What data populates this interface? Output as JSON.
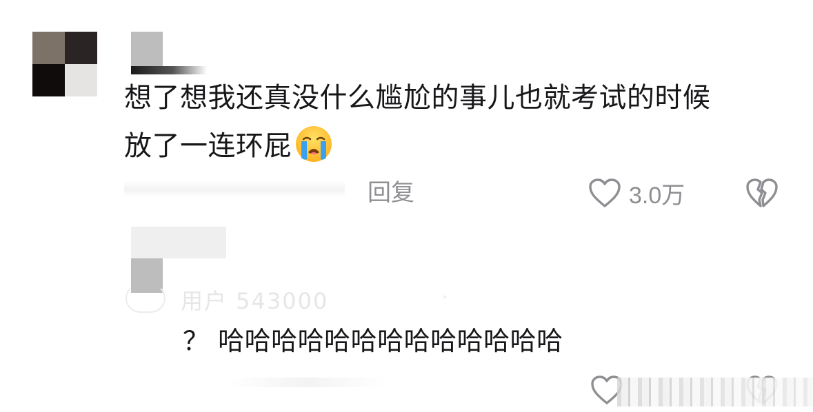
{
  "comment": {
    "text_line1": "想了想我还真没什么尴尬的事儿也就考试的时候",
    "text_line2": "放了一连环屁",
    "emoji": "loudly-crying-face",
    "reply_label": "回复",
    "like_count": "3.0万",
    "icons": {
      "like": "heart-outline-icon",
      "dislike": "broken-heart-icon"
    }
  },
  "reply": {
    "text": "？ 哈哈哈哈哈哈哈哈哈哈哈哈哈"
  },
  "colors": {
    "text": "#17171a",
    "secondary": "#8e8e93",
    "emoji_face": "#ffc83d",
    "emoji_tears": "#3aa0f0"
  }
}
